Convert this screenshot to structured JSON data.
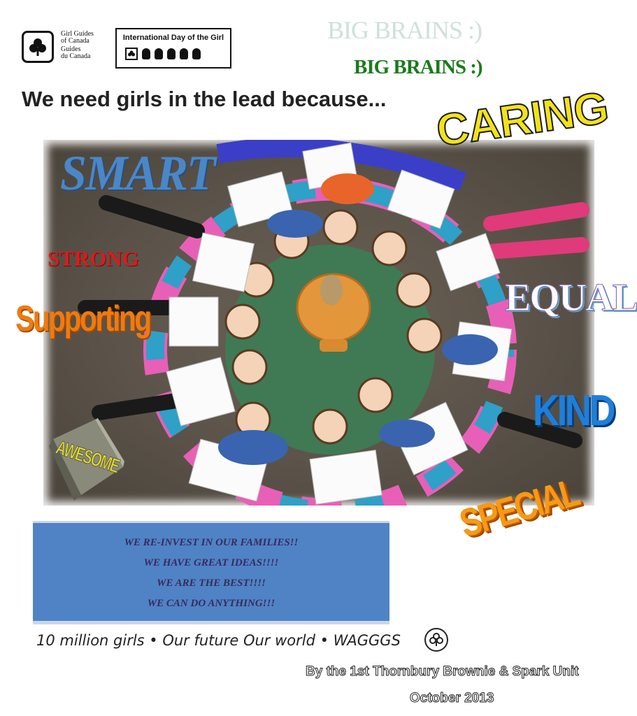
{
  "logos": {
    "girl_guides_lines": [
      "Girl Guides",
      "of Canada",
      "Guides",
      "du Canada"
    ],
    "idg_title": "International Day of the Girl"
  },
  "header": {
    "faded_title": "BIG BRAINS :)",
    "green_title": "BIG BRAINS :)",
    "headline": "We need girls in the lead because..."
  },
  "words": {
    "smart": "SMART",
    "caring": "CARING",
    "strong": "STRONG",
    "supporting": "Supporting",
    "equal": "EQUAL",
    "kind": "KIND",
    "awesome": "AWESOME",
    "special": "SPECIAL"
  },
  "reinvest_box": {
    "lines": [
      "WE RE-INVEST IN OUR FAMILIES!!",
      "WE HAVE GREAT IDEAS!!!!",
      "WE ARE THE BEST!!!!",
      "WE CAN DO ANYTHING!!!"
    ]
  },
  "footer": {
    "slogan": "10 million girls • Our future Our world • WAGGGS",
    "credit": "By the 1st Thornbury Brownie & Spark Unit",
    "date": "October 2013"
  },
  "colors": {
    "headline": "#222222",
    "green_title": "#1b7a1b",
    "box_blue": "#4f83c6",
    "smart": "#4a87c7",
    "caring": "#f2e21a",
    "strong": "#d41e1e",
    "supporting": "#f07a10",
    "kind": "#1f7fd8",
    "special": "#f59a16"
  }
}
